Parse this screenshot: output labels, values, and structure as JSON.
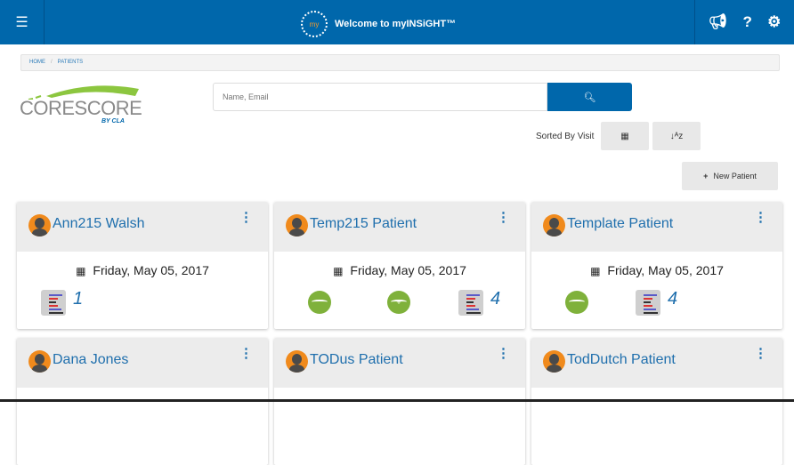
{
  "header": {
    "title": "Welcome to myINSiGHT™",
    "logo_text": "my",
    "menu_icon": "hamburger-icon",
    "icons": [
      "megaphone-icon",
      "help-icon",
      "gear-icon"
    ]
  },
  "breadcrumb": [
    "HOME",
    "PATIENTS"
  ],
  "logo": {
    "name": "CORESCORE",
    "sub": "BY CLA"
  },
  "search": {
    "placeholder": "Name, Email",
    "value": ""
  },
  "sort": {
    "label": "Sorted By Visit"
  },
  "new_patient_label": "New Patient",
  "colors": {
    "primary": "#0067ab",
    "accent_green": "#7fb13b",
    "avatar": "#f08a1c"
  },
  "patients": [
    {
      "name": "Ann215 Walsh",
      "date": "Friday, May 05, 2017",
      "circles": 0,
      "reports": "1"
    },
    {
      "name": "Temp215 Patient",
      "date": "Friday, May 05, 2017",
      "circles": 2,
      "reports": "4"
    },
    {
      "name": "Template Patient",
      "date": "Friday, May 05, 2017",
      "circles": 1,
      "reports": "4"
    },
    {
      "name": "Dana Jones"
    },
    {
      "name": "TODus Patient"
    },
    {
      "name": "TodDutch Patient"
    }
  ]
}
